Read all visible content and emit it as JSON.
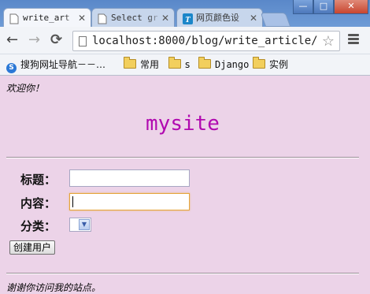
{
  "browser": {
    "tabs": [
      {
        "title": "write_art",
        "active": true
      },
      {
        "title": "Select gr",
        "active": false
      },
      {
        "title": "网页颜色设",
        "active": false
      }
    ],
    "window_controls": {
      "minimize": "—",
      "restore": "□",
      "close": "✕"
    },
    "toolbar": {
      "back": "←",
      "forward": "→",
      "reload": "⟳",
      "url": "localhost:8000/blog/write_article/",
      "star": "☆"
    },
    "bookmarks": [
      {
        "label": "搜狗网址导航－－…",
        "icon": "sogou-icon"
      },
      {
        "label": "常用",
        "icon": "folder-icon"
      },
      {
        "label": "s",
        "icon": "folder-icon"
      },
      {
        "label": "Django",
        "icon": "folder-icon"
      },
      {
        "label": "实例",
        "icon": "folder-icon"
      }
    ]
  },
  "page": {
    "welcome": "欢迎你！",
    "site_title": "mysite",
    "form": {
      "title_label": "标题：",
      "title_value": "",
      "content_label": "内容：",
      "content_value": "",
      "category_label": "分类：",
      "category_value": "",
      "submit_label": "创建用户"
    },
    "footer": "谢谢你访问我的站点。"
  },
  "colors": {
    "page_background": "#ecd3e8",
    "site_title": "#b10ab0",
    "input_focus": "#e5a43a"
  }
}
